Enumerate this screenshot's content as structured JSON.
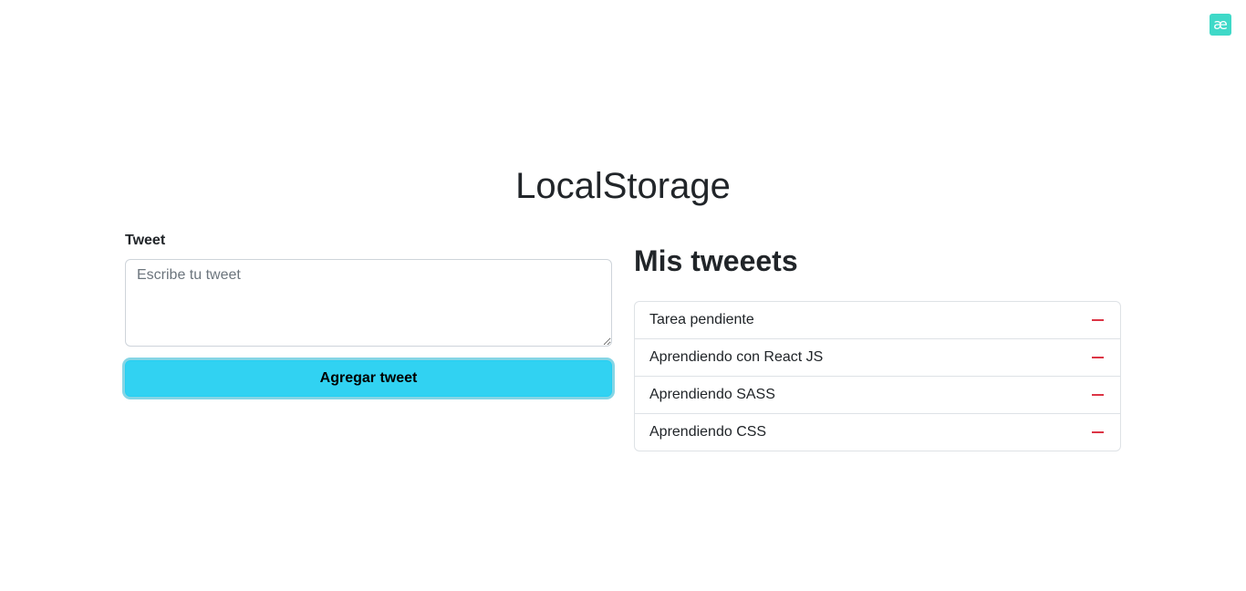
{
  "extension": {
    "glyph": "æ",
    "color": "#3fd9c8"
  },
  "page": {
    "title": "LocalStorage"
  },
  "form": {
    "label": "Tweet",
    "textarea_placeholder": "Escribe tu tweet",
    "textarea_value": "",
    "submit_label": "Agregar tweet",
    "button_color": "#31d2f2"
  },
  "list": {
    "title": "Mis tweeets",
    "items": [
      {
        "text": "Tarea pendiente",
        "icon": "minus-icon"
      },
      {
        "text": "Aprendiendo con React JS",
        "icon": "minus-icon"
      },
      {
        "text": "Aprendiendo SASS",
        "icon": "minus-icon"
      },
      {
        "text": "Aprendiendo CSS",
        "icon": "minus-icon"
      }
    ],
    "remove_color": "#dc3545"
  }
}
